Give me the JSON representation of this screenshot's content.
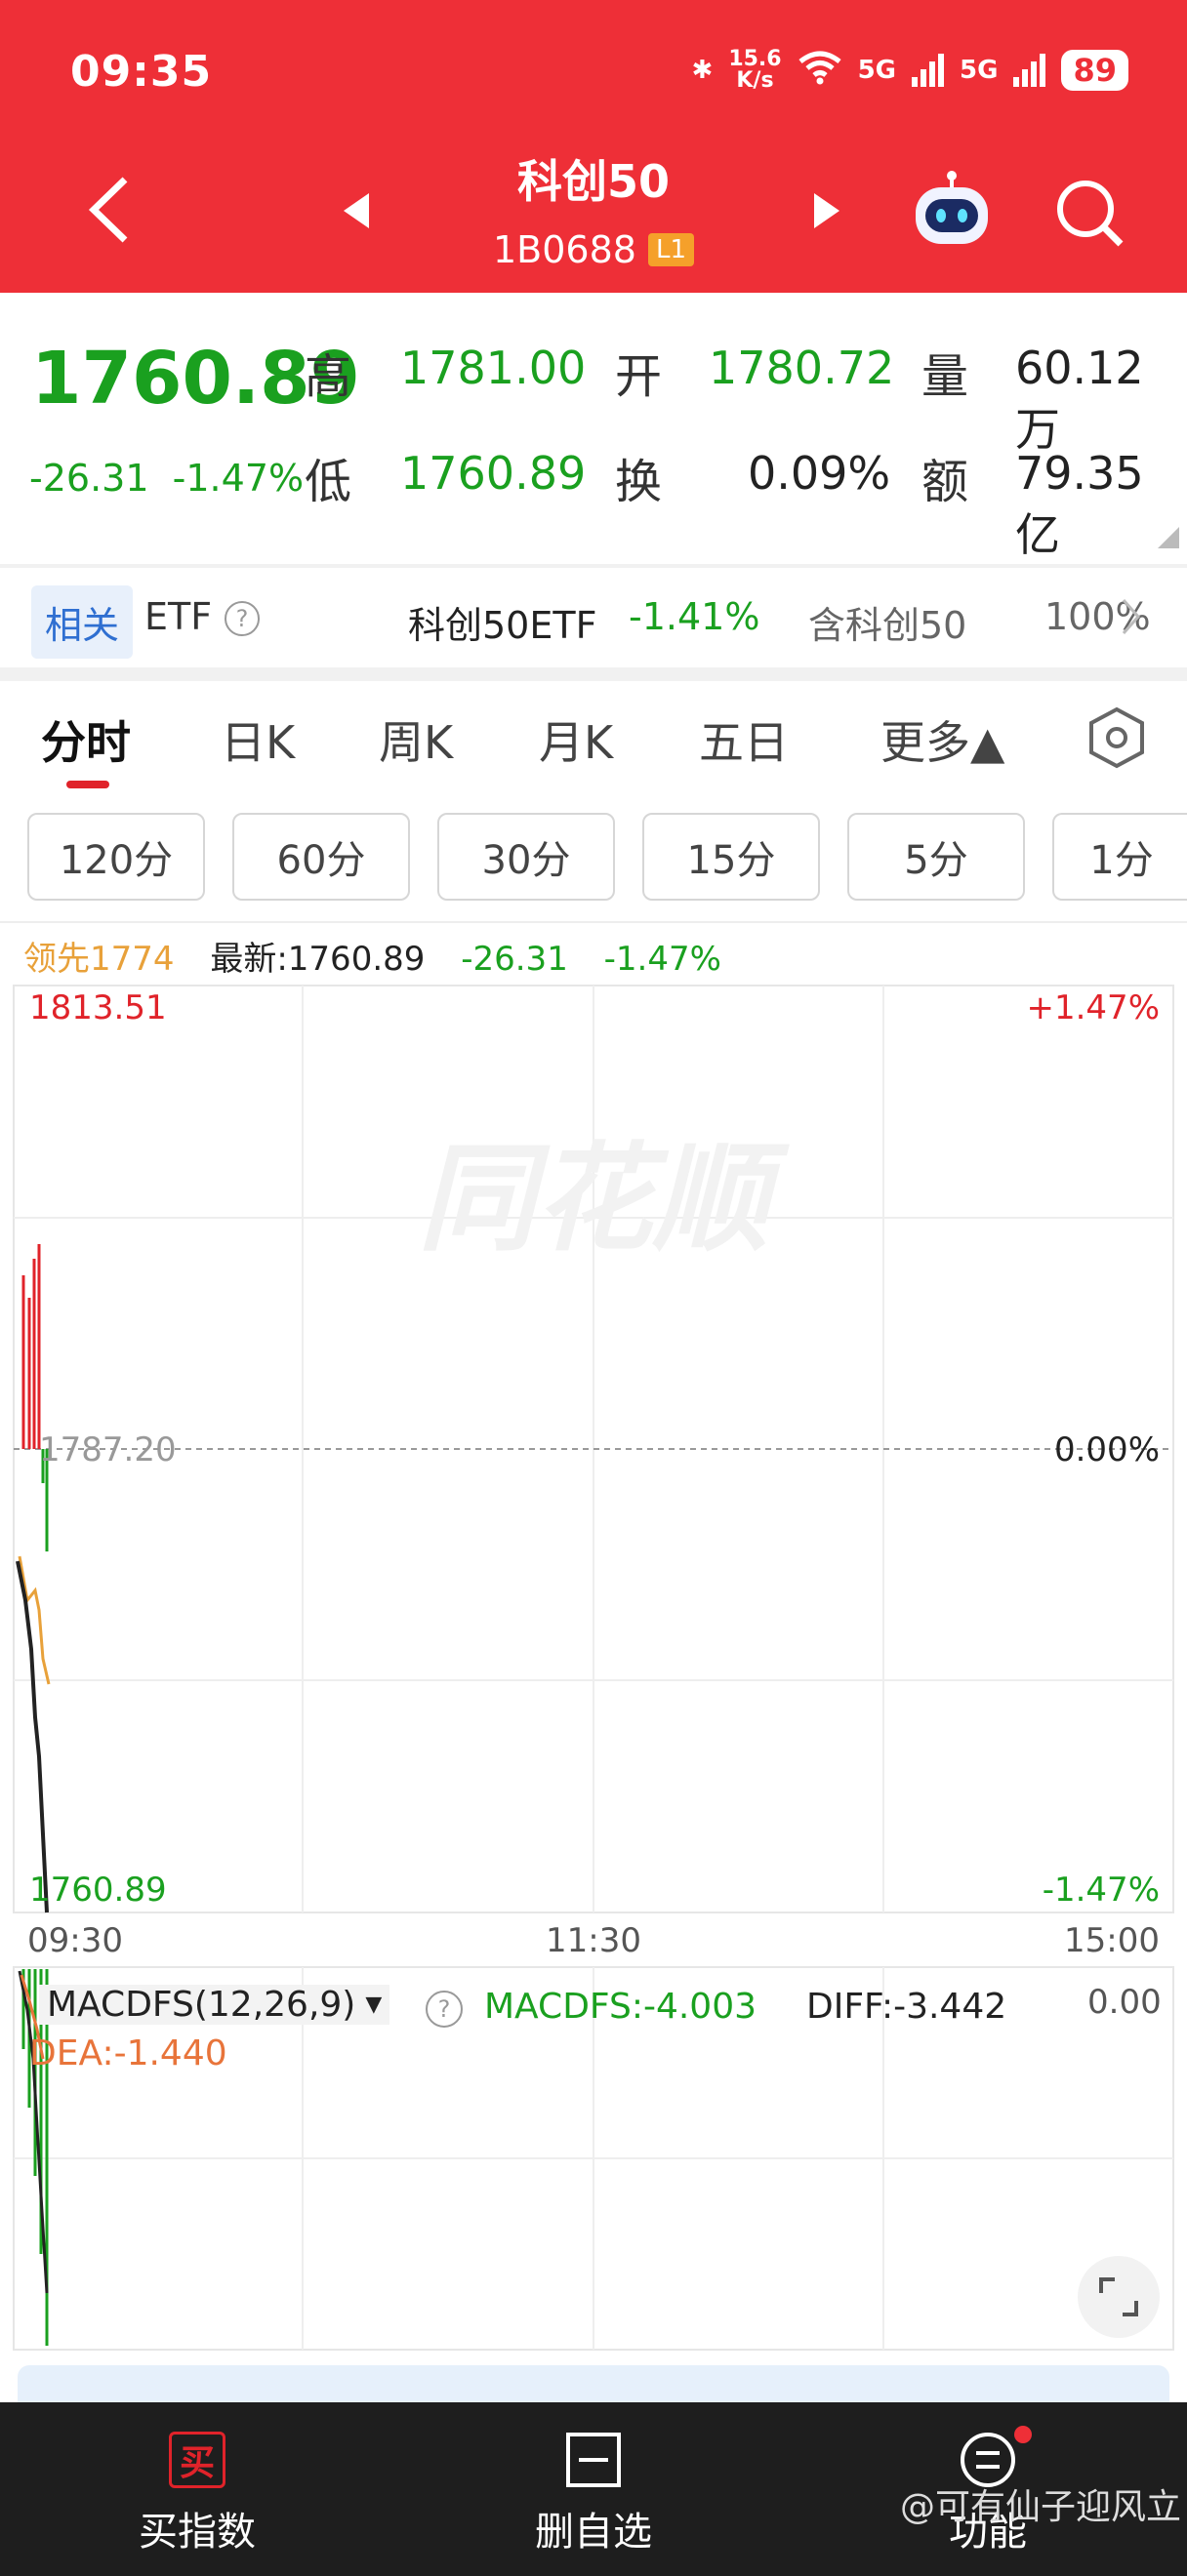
{
  "status": {
    "time": "09:35",
    "net_speed_value": "15.6",
    "net_speed_unit": "K/s",
    "battery": "89",
    "wifi_badge": "6",
    "sim1": "5G",
    "sim2": "5G"
  },
  "header": {
    "title": "科创50",
    "code": "1B0688",
    "level": "L1"
  },
  "quote": {
    "price": "1760.89",
    "change": "-26.31",
    "change_pct": "-1.47%",
    "high_label": "高",
    "high": "1781.00",
    "low_label": "低",
    "low": "1760.89",
    "open_label": "开",
    "open": "1780.72",
    "turnover_label": "换",
    "turnover": "0.09%",
    "volume_label": "量",
    "volume": "60.12万",
    "amount_label": "额",
    "amount": "79.35亿"
  },
  "etf": {
    "related_tag": "相关",
    "label": "ETF",
    "help": "?",
    "etf_name": "科创50ETF",
    "etf_change": "-1.41%",
    "contains": "含科创50",
    "contains_pct": "100%"
  },
  "tabs": [
    {
      "label": "分时"
    },
    {
      "label": "日K"
    },
    {
      "label": "周K"
    },
    {
      "label": "月K"
    },
    {
      "label": "五日"
    },
    {
      "label": "更多▲"
    }
  ],
  "periods": [
    "120分",
    "60分",
    "30分",
    "15分",
    "5分",
    "1分"
  ],
  "info": {
    "leader": "领先1774",
    "latest": "最新:1760.89",
    "change": "-26.31",
    "change_pct": "-1.47%"
  },
  "chart_labels": {
    "top_price": "1813.51",
    "top_pct": "+1.47%",
    "mid_price": "1787.20",
    "mid_pct": "0.00%",
    "bottom_price": "1760.89",
    "bottom_pct": "-1.47%",
    "time_start": "09:30",
    "time_mid": "11:30",
    "time_end": "15:00",
    "watermark": "同花顺"
  },
  "macd": {
    "name": "MACDFS(12,26,9)",
    "help": "?",
    "macdfs": "MACDFS:-4.003",
    "diff": "DIFF:-3.442",
    "dea": "DEA:-1.440",
    "zero": "0.00"
  },
  "bottom": {
    "buy_icon": "买",
    "buy_label": "买指数",
    "delete_label": "删自选",
    "func_label": "功能"
  },
  "footer_watermark": "@可有仙子迎风立",
  "colors": {
    "header_red": "#ee2f37",
    "up_red": "#e0232a",
    "down_green": "#1aa01f",
    "avg_line": "#e8a13a",
    "price_line": "#222222"
  }
}
